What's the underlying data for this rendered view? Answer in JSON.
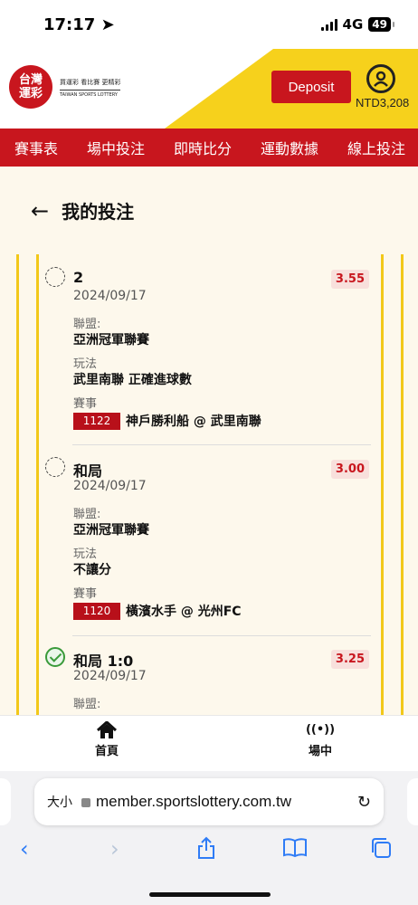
{
  "status": {
    "time": "17:17",
    "network": "4G",
    "battery": "49"
  },
  "header": {
    "logo_line1": "台灣",
    "logo_line2": "運彩",
    "slogan": "買運彩 看比賽 更精彩",
    "slogan_en": "TAIWAN SPORTS LOTTERY",
    "deposit_label": "Deposit",
    "balance": "NTD3,208"
  },
  "nav": {
    "items": [
      "賽事表",
      "場中投注",
      "即時比分",
      "運動數據",
      "線上投注"
    ]
  },
  "page": {
    "title": "我的投注"
  },
  "labels": {
    "league": "聯盟:",
    "play": "玩法",
    "event": "賽事"
  },
  "bets": [
    {
      "selection": "2",
      "date": "2024/09/17",
      "odds": "3.55",
      "league": "亞洲冠軍聯賽",
      "play": "武里南聯 正確進球數",
      "code": "1122",
      "match": "神戶勝利船 @ 武里南聯",
      "settled": false
    },
    {
      "selection": "和局",
      "date": "2024/09/17",
      "odds": "3.00",
      "league": "亞洲冠軍聯賽",
      "play": "不讓分",
      "code": "1120",
      "match": "橫濱水手 @ 光州FC",
      "settled": false
    },
    {
      "selection": "和局 1:0",
      "date": "2024/09/17",
      "odds": "3.25",
      "settled": true
    }
  ],
  "apptabs": {
    "home": "首頁",
    "live": "場中",
    "live_icon": "((•))"
  },
  "browser": {
    "aa": "大小",
    "url": "member.sportslottery.com.tw"
  }
}
